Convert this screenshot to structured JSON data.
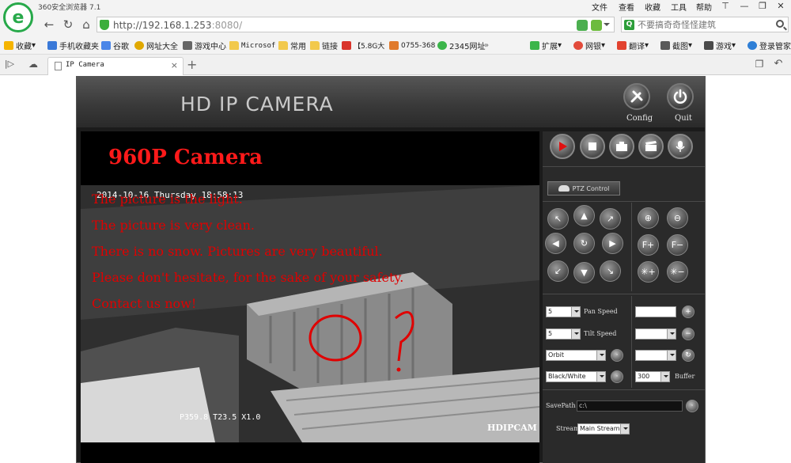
{
  "browser": {
    "title": "360安全浏览器 7.1",
    "menu": [
      "文件",
      "查看",
      "收藏",
      "工具",
      "帮助"
    ],
    "address": {
      "url": "http://192.168.1.253",
      "port": ":8080/"
    },
    "search": {
      "placeholder": "不要搞奇奇怪怪建筑"
    },
    "bookmarks": [
      "收藏",
      "手机收藏夹",
      "谷歌",
      "网址大全",
      "游戏中心",
      "Microsof",
      "常用",
      "链接",
      "【5.8G大",
      "0755-368",
      "2345网址",
      "扩展",
      "网银",
      "翻译",
      "截图",
      "游戏",
      "登录管家"
    ],
    "tab": {
      "title": "IP Camera",
      "close": "×",
      "new": "+"
    }
  },
  "camera": {
    "brand": "HD IP CAMERA",
    "config_label": "Config",
    "quit_label": "Quit",
    "heading": "960P Camera",
    "lines": [
      "The picture is the light.",
      "The picture is very clean.",
      "There is no snow. Pictures are very beautiful.",
      "Please don't hesitate, for the sake of your safety.",
      "Contact us now!"
    ],
    "osd_time": "2014-10-16  Thursday  18:58:13",
    "osd_ptz": "P359.8  T23.5  X1.0",
    "osd_brand": "HDIPCAM",
    "ptz_control": "PTZ Control",
    "pan_speed": {
      "value": "5",
      "label": "Pan Speed"
    },
    "tilt_speed": {
      "value": "5",
      "label": "Tilt Speed"
    },
    "orbit": "Orbit",
    "color_mode": "Black/White",
    "buffer": {
      "value": "300",
      "label": "Buffer"
    },
    "savepath": {
      "label": "SavePath",
      "value": "c:\\"
    },
    "stream": {
      "label": "Stream",
      "value": "Main Stream"
    }
  }
}
